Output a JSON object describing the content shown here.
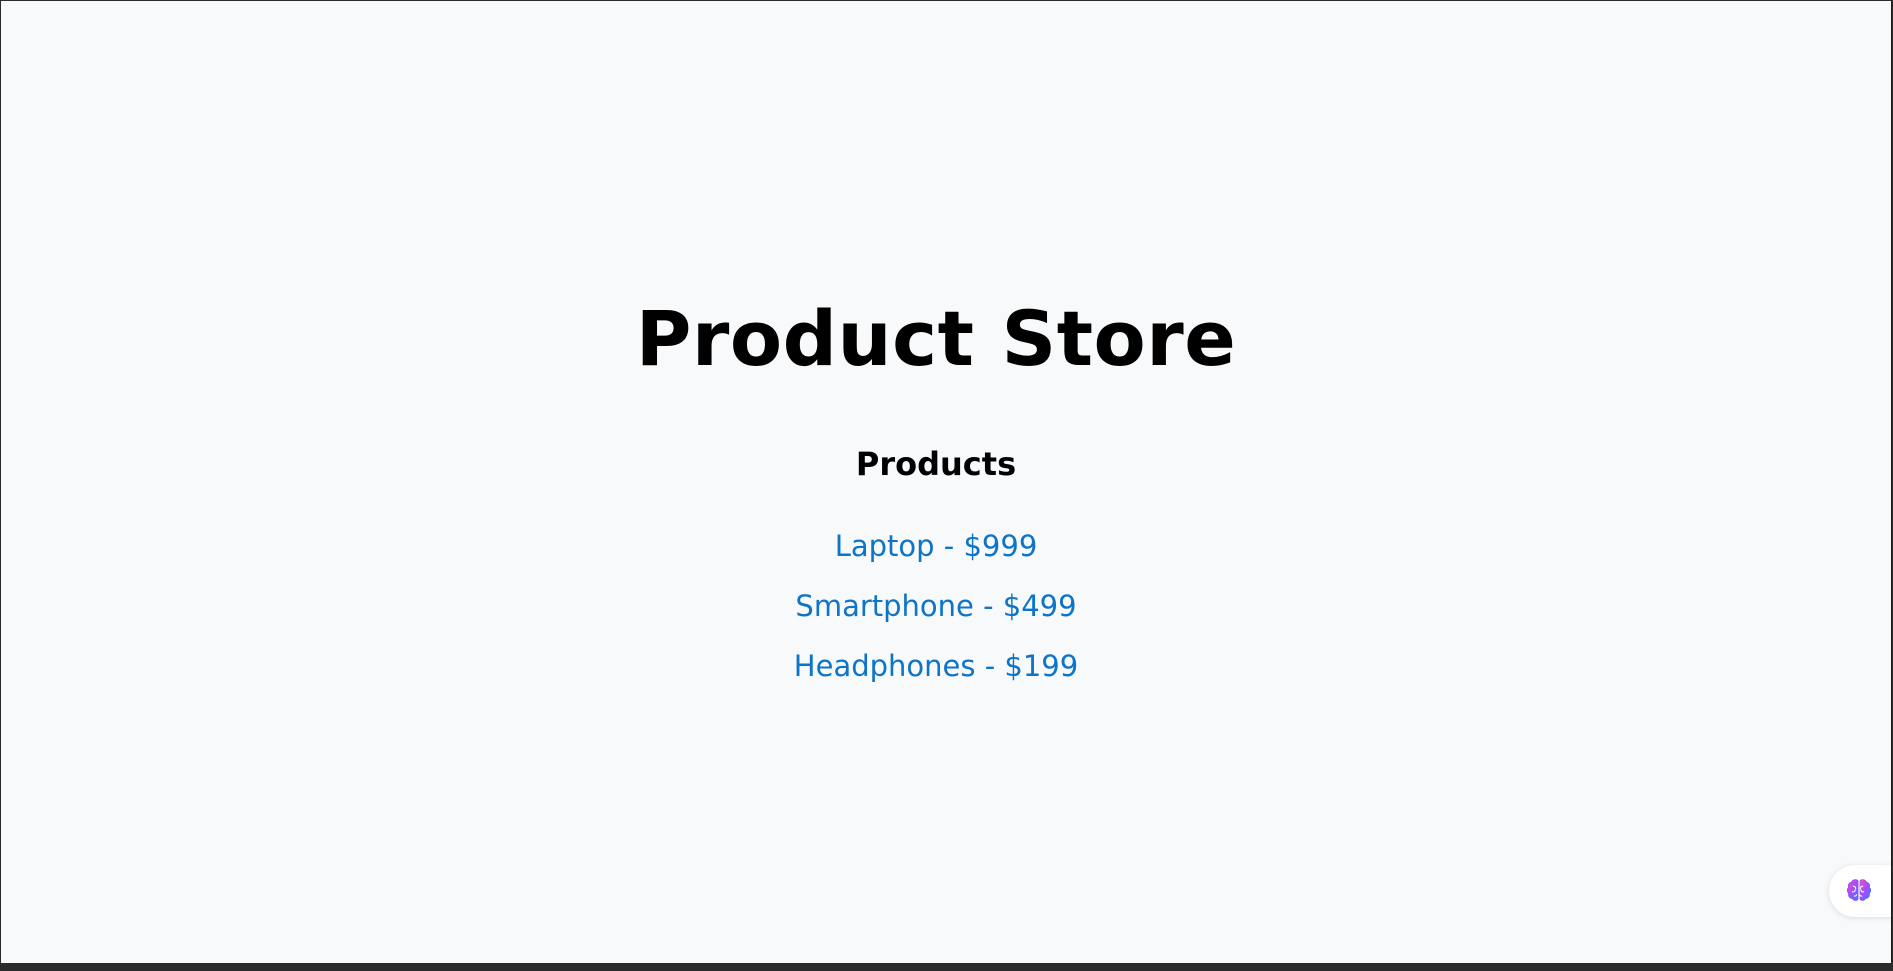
{
  "header": {
    "title": "Product Store"
  },
  "products": {
    "heading": "Products",
    "items": [
      {
        "label": "Laptop - $999"
      },
      {
        "label": "Smartphone - $499"
      },
      {
        "label": "Headphones - $199"
      }
    ]
  },
  "assistant": {
    "icon": "brain-icon"
  },
  "colors": {
    "background": "#f7f9fb",
    "link": "#0e74c8",
    "text": "#000000"
  }
}
